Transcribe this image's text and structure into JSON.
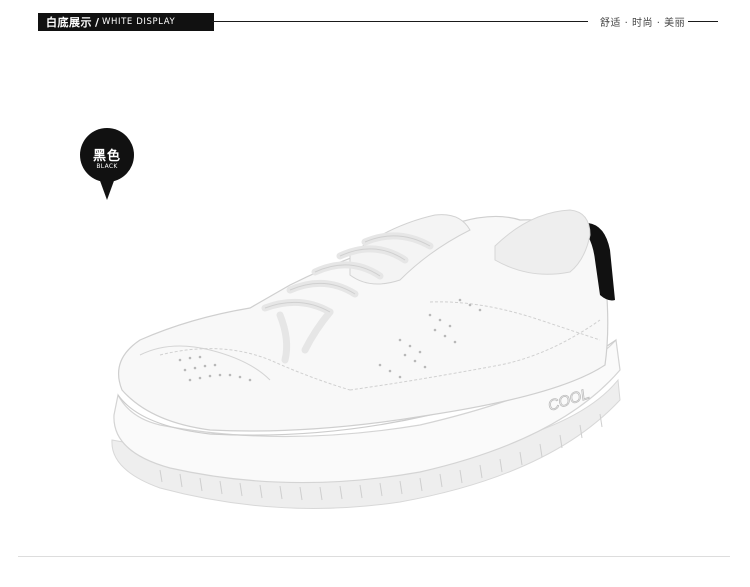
{
  "header": {
    "tag_cn": "白底展示",
    "tag_sep": "/",
    "tag_en": "WHITE DISPLAY",
    "slogan": "舒适 · 时尚 · 美丽"
  },
  "color_badge": {
    "label_cn": "黑色",
    "label_en": "BLACK",
    "badge_color": "#111111"
  },
  "product": {
    "image_description_icon": "white-sneaker-icon",
    "sole_text": "COOL",
    "upper_color": "#f7f7f7",
    "heel_tab_color": "#111111"
  }
}
